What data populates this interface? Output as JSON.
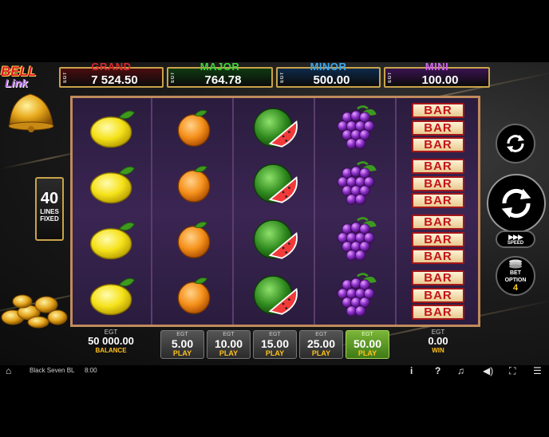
{
  "logo": {
    "line1": "BELL",
    "line2": "Link"
  },
  "jackpots": [
    {
      "egt": "EGT",
      "name": "GRAND",
      "value": "7 524.50",
      "name_color": "#e0262b",
      "bg": "#4a0d10"
    },
    {
      "egt": "EGT",
      "name": "MAJOR",
      "value": "764.78",
      "name_color": "#3fd63a",
      "bg": "#0f3a10"
    },
    {
      "egt": "EGT",
      "name": "MINOR",
      "value": "500.00",
      "name_color": "#3aa8f0",
      "bg": "#0c2a4a"
    },
    {
      "egt": "EGT",
      "name": "MINI",
      "value": "100.00",
      "name_color": "#d063f0",
      "bg": "#3a1350"
    }
  ],
  "lines": {
    "count": "40",
    "label1": "LINES",
    "label2": "FIXED"
  },
  "reels": [
    [
      "lemon",
      "lemon",
      "lemon",
      "lemon"
    ],
    [
      "orange",
      "orange",
      "orange",
      "orange"
    ],
    [
      "watermelon",
      "watermelon",
      "watermelon",
      "watermelon"
    ],
    [
      "grapes",
      "grapes",
      "grapes",
      "grapes"
    ],
    [
      "bar-triple",
      "bar-triple",
      "bar-triple",
      "bar-triple"
    ]
  ],
  "bar_text": "BAR",
  "controls": {
    "autoplay_icon": "autoplay-icon",
    "spin_icon": "spin-icon",
    "speed_label": "SPEED",
    "bet_option_label1": "BET",
    "bet_option_label2": "OPTION",
    "bet_option_value": "4"
  },
  "balance": {
    "egt": "EGT",
    "value": "50 000.00",
    "label": "BALANCE"
  },
  "win": {
    "egt": "EGT",
    "value": "0.00",
    "label": "WIN"
  },
  "bets": [
    {
      "egt": "EGT",
      "value": "5.00",
      "play": "PLAY",
      "active": false
    },
    {
      "egt": "EGT",
      "value": "10.00",
      "play": "PLAY",
      "active": false
    },
    {
      "egt": "EGT",
      "value": "15.00",
      "play": "PLAY",
      "active": false
    },
    {
      "egt": "EGT",
      "value": "25.00",
      "play": "PLAY",
      "active": false
    },
    {
      "egt": "EGT",
      "value": "50.00",
      "play": "PLAY",
      "active": true
    }
  ],
  "status": {
    "game_name": "Black Seven BL",
    "time": "8:00",
    "icons": [
      "home-icon",
      "info-icon",
      "help-icon",
      "music-icon",
      "sound-icon",
      "fullscreen-icon",
      "settings-icon"
    ]
  }
}
